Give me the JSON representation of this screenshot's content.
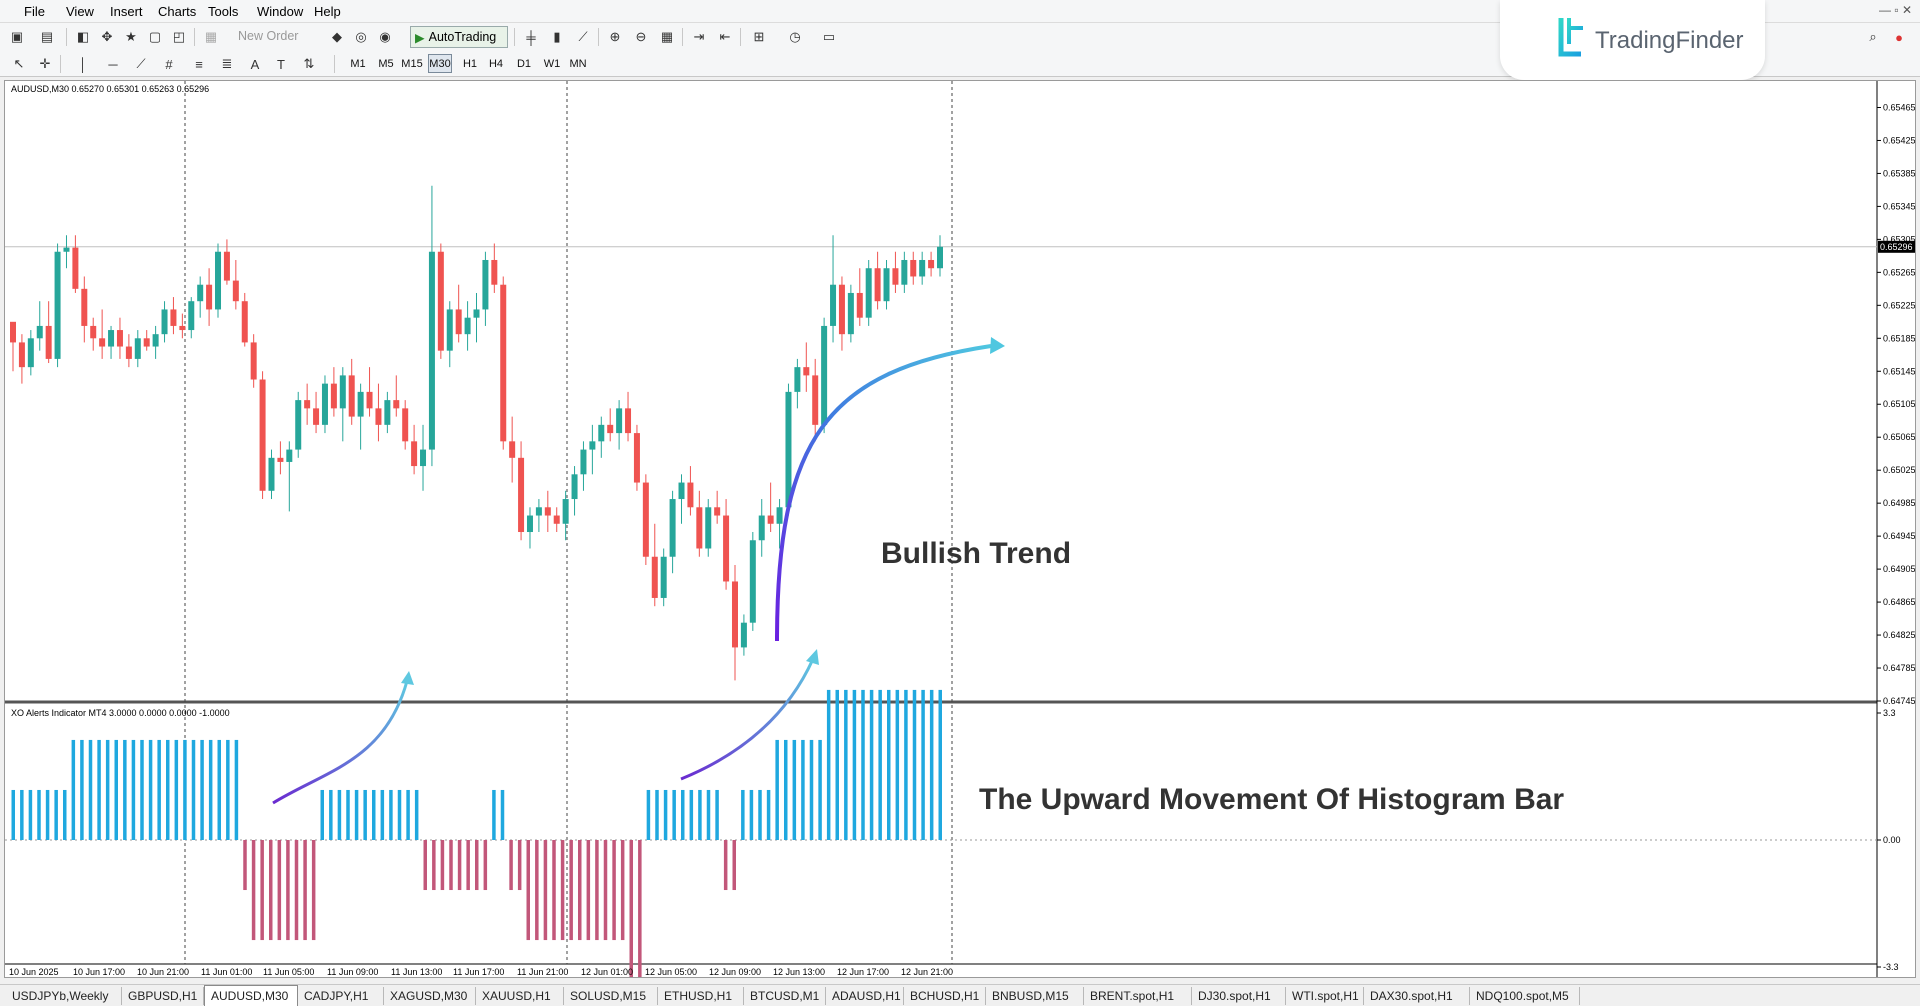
{
  "menu": [
    "File",
    "View",
    "Insert",
    "Charts",
    "Tools",
    "Window",
    "Help"
  ],
  "toolbar": {
    "new_order": "New Order",
    "autotrading": "AutoTrading"
  },
  "timeframes": [
    "M1",
    "M5",
    "M15",
    "M30",
    "H1",
    "H4",
    "D1",
    "W1",
    "MN"
  ],
  "active_timeframe": "M30",
  "logo": {
    "text": "TradingFinder"
  },
  "chart": {
    "info": "AUDUSD,M30  0.65270 0.65301 0.65263 0.65296",
    "current_price": "0.65296",
    "price_ticks": [
      "0.65465",
      "0.65425",
      "0.65385",
      "0.65345",
      "0.65305",
      "0.65265",
      "0.65225",
      "0.65185",
      "0.65145",
      "0.65105",
      "0.65065",
      "0.65025",
      "0.64985",
      "0.64945",
      "0.64905",
      "0.64865",
      "0.64825",
      "0.64785",
      "0.64745"
    ],
    "time_labels": [
      "10 Jun 2025",
      "10 Jun 17:00",
      "10 Jun 21:00",
      "11 Jun 01:00",
      "11 Jun 05:00",
      "11 Jun 09:00",
      "11 Jun 13:00",
      "11 Jun 17:00",
      "11 Jun 21:00",
      "12 Jun 01:00",
      "12 Jun 05:00",
      "12 Jun 09:00",
      "12 Jun 13:00",
      "12 Jun 17:00",
      "12 Jun 21:00"
    ],
    "indicator_info": "XO Alerts Indicator MT4 3.0000 0.0000 0.0000 -1.0000",
    "indicator_ticks": [
      "3.3",
      "0.00",
      "-3.3"
    ],
    "annotation_trend": "Bullish Trend",
    "annotation_histogram": "The Upward Movement Of Histogram Bar",
    "colors": {
      "bull": "#26a69a",
      "bear": "#ef5350",
      "hist_up": "#1fa8df",
      "hist_down": "#c2577a"
    }
  },
  "chart_data": {
    "type": "bar",
    "title": "",
    "xlabel": "",
    "ylabel": "",
    "ylim": [
      -3.3,
      3.3
    ],
    "categories": [
      "10 Jun 2025",
      "10 Jun 17:00",
      "10 Jun 21:00",
      "11 Jun 01:00",
      "11 Jun 05:00",
      "11 Jun 09:00",
      "11 Jun 13:00",
      "11 Jun 17:00",
      "11 Jun 21:00",
      "12 Jun 01:00",
      "12 Jun 05:00",
      "12 Jun 09:00",
      "12 Jun 13:00",
      "12 Jun 17:00",
      "12 Jun 21:00"
    ],
    "candles": [
      [
        0.65205,
        0.652,
        0.65145,
        0.6518
      ],
      [
        0.6518,
        0.6519,
        0.6513,
        0.6515
      ],
      [
        0.6515,
        0.65195,
        0.6514,
        0.65185
      ],
      [
        0.65185,
        0.6523,
        0.6517,
        0.652
      ],
      [
        0.652,
        0.6523,
        0.65155,
        0.6516
      ],
      [
        0.6516,
        0.653,
        0.6515,
        0.6529
      ],
      [
        0.6529,
        0.6531,
        0.6527,
        0.65295
      ],
      [
        0.65295,
        0.6531,
        0.6524,
        0.65245
      ],
      [
        0.65245,
        0.6526,
        0.6518,
        0.652
      ],
      [
        0.652,
        0.6521,
        0.6517,
        0.65185
      ],
      [
        0.65185,
        0.6522,
        0.6516,
        0.65175
      ],
      [
        0.65175,
        0.652,
        0.6516,
        0.65195
      ],
      [
        0.65195,
        0.6521,
        0.6516,
        0.65175
      ],
      [
        0.65175,
        0.6519,
        0.6515,
        0.6516
      ],
      [
        0.6516,
        0.65195,
        0.6515,
        0.65185
      ],
      [
        0.65185,
        0.65195,
        0.6517,
        0.65175
      ],
      [
        0.65175,
        0.652,
        0.6516,
        0.6519
      ],
      [
        0.6519,
        0.6523,
        0.6518,
        0.6522
      ],
      [
        0.6522,
        0.65235,
        0.6519,
        0.652
      ],
      [
        0.652,
        0.65215,
        0.65185,
        0.65195
      ],
      [
        0.65195,
        0.65235,
        0.65185,
        0.6523
      ],
      [
        0.6523,
        0.6526,
        0.6521,
        0.6525
      ],
      [
        0.6525,
        0.6527,
        0.652,
        0.6522
      ],
      [
        0.6522,
        0.653,
        0.6521,
        0.6529
      ],
      [
        0.6529,
        0.65305,
        0.6525,
        0.65255
      ],
      [
        0.65255,
        0.6528,
        0.6522,
        0.6523
      ],
      [
        0.6523,
        0.6524,
        0.65175,
        0.6518
      ],
      [
        0.6518,
        0.6519,
        0.65125,
        0.65135
      ],
      [
        0.65135,
        0.65145,
        0.6499,
        0.65
      ],
      [
        0.65,
        0.6505,
        0.6499,
        0.6504
      ],
      [
        0.6504,
        0.6506,
        0.6502,
        0.65035
      ],
      [
        0.65035,
        0.6506,
        0.64975,
        0.6505
      ],
      [
        0.6505,
        0.6512,
        0.6504,
        0.6511
      ],
      [
        0.6511,
        0.6513,
        0.6508,
        0.651
      ],
      [
        0.651,
        0.6512,
        0.6507,
        0.6508
      ],
      [
        0.6508,
        0.6514,
        0.6507,
        0.6513
      ],
      [
        0.6513,
        0.6515,
        0.6509,
        0.651
      ],
      [
        0.651,
        0.6515,
        0.6506,
        0.6514
      ],
      [
        0.6514,
        0.6516,
        0.6508,
        0.6509
      ],
      [
        0.6509,
        0.6513,
        0.6505,
        0.6512
      ],
      [
        0.6512,
        0.6515,
        0.6509,
        0.651
      ],
      [
        0.651,
        0.6513,
        0.6506,
        0.6508
      ],
      [
        0.6508,
        0.6512,
        0.6507,
        0.6511
      ],
      [
        0.6511,
        0.6514,
        0.6509,
        0.651
      ],
      [
        0.651,
        0.6511,
        0.6505,
        0.6506
      ],
      [
        0.6506,
        0.6508,
        0.6502,
        0.6503
      ],
      [
        0.6503,
        0.6508,
        0.65,
        0.6505
      ],
      [
        0.6505,
        0.6537,
        0.6503,
        0.6529
      ],
      [
        0.6529,
        0.653,
        0.6516,
        0.6517
      ],
      [
        0.6517,
        0.6523,
        0.6515,
        0.6522
      ],
      [
        0.6522,
        0.6525,
        0.6518,
        0.6519
      ],
      [
        0.6519,
        0.6523,
        0.6517,
        0.6521
      ],
      [
        0.6521,
        0.6524,
        0.6518,
        0.6522
      ],
      [
        0.6522,
        0.6529,
        0.652,
        0.6528
      ],
      [
        0.6528,
        0.653,
        0.6524,
        0.6525
      ],
      [
        0.6525,
        0.6526,
        0.6505,
        0.6506
      ],
      [
        0.6506,
        0.6509,
        0.6501,
        0.6504
      ],
      [
        0.6504,
        0.6506,
        0.6494,
        0.6495
      ],
      [
        0.6495,
        0.6498,
        0.6493,
        0.6497
      ],
      [
        0.6497,
        0.6499,
        0.6495,
        0.6498
      ],
      [
        0.6498,
        0.65,
        0.6495,
        0.6497
      ],
      [
        0.6497,
        0.6498,
        0.6495,
        0.6496
      ],
      [
        0.6496,
        0.65,
        0.6494,
        0.6499
      ],
      [
        0.6499,
        0.6503,
        0.6497,
        0.6502
      ],
      [
        0.6502,
        0.6506,
        0.65,
        0.6505
      ],
      [
        0.6505,
        0.6508,
        0.6502,
        0.6506
      ],
      [
        0.6506,
        0.6509,
        0.6504,
        0.6508
      ],
      [
        0.6508,
        0.651,
        0.6506,
        0.6507
      ],
      [
        0.6507,
        0.6511,
        0.6505,
        0.651
      ],
      [
        0.651,
        0.6512,
        0.6506,
        0.6507
      ],
      [
        0.6507,
        0.6508,
        0.65,
        0.6501
      ],
      [
        0.6501,
        0.6502,
        0.6491,
        0.6492
      ],
      [
        0.6492,
        0.6496,
        0.6486,
        0.6487
      ],
      [
        0.6487,
        0.6493,
        0.6486,
        0.6492
      ],
      [
        0.6492,
        0.65,
        0.649,
        0.6499
      ],
      [
        0.6499,
        0.6502,
        0.6496,
        0.6501
      ],
      [
        0.6501,
        0.6503,
        0.6497,
        0.6498
      ],
      [
        0.6498,
        0.65,
        0.6492,
        0.6493
      ],
      [
        0.6493,
        0.6499,
        0.6492,
        0.6498
      ],
      [
        0.6498,
        0.65,
        0.6496,
        0.6497
      ],
      [
        0.6497,
        0.6499,
        0.6488,
        0.6489
      ],
      [
        0.6489,
        0.6491,
        0.6477,
        0.6481
      ],
      [
        0.6481,
        0.6485,
        0.648,
        0.6484
      ],
      [
        0.6484,
        0.6495,
        0.6483,
        0.6494
      ],
      [
        0.6494,
        0.6499,
        0.6492,
        0.6497
      ],
      [
        0.6497,
        0.6501,
        0.6495,
        0.6496
      ],
      [
        0.6496,
        0.6499,
        0.6493,
        0.6498
      ],
      [
        0.6498,
        0.6513,
        0.6497,
        0.6512
      ],
      [
        0.6512,
        0.6516,
        0.651,
        0.6515
      ],
      [
        0.6515,
        0.6518,
        0.6512,
        0.6514
      ],
      [
        0.6514,
        0.6516,
        0.6506,
        0.6508
      ],
      [
        0.6508,
        0.6521,
        0.6507,
        0.652
      ],
      [
        0.652,
        0.6531,
        0.6518,
        0.6525
      ],
      [
        0.6525,
        0.6526,
        0.6517,
        0.6519
      ],
      [
        0.6519,
        0.6525,
        0.6518,
        0.6524
      ],
      [
        0.6524,
        0.6527,
        0.652,
        0.6521
      ],
      [
        0.6521,
        0.6528,
        0.652,
        0.6527
      ],
      [
        0.6527,
        0.6529,
        0.6522,
        0.6523
      ],
      [
        0.6523,
        0.6528,
        0.6522,
        0.6527
      ],
      [
        0.6527,
        0.6529,
        0.6524,
        0.6525
      ],
      [
        0.6525,
        0.6529,
        0.6524,
        0.6528
      ],
      [
        0.6528,
        0.6529,
        0.6525,
        0.6526
      ],
      [
        0.6526,
        0.6529,
        0.6525,
        0.6528
      ],
      [
        0.6528,
        0.6529,
        0.6526,
        0.6527
      ],
      [
        0.6527,
        0.6531,
        0.6526,
        0.65296
      ]
    ],
    "histogram": [
      1,
      1,
      1,
      1,
      1,
      1,
      1,
      2,
      2,
      2,
      2,
      2,
      2,
      2,
      2,
      2,
      2,
      2,
      2,
      2,
      2,
      2,
      2,
      2,
      2,
      2,
      2,
      -1,
      -2,
      -2,
      -2,
      -2,
      -2,
      -2,
      -2,
      -2,
      1,
      1,
      1,
      1,
      1,
      1,
      1,
      1,
      1,
      1,
      1,
      1,
      -1,
      -1,
      -1,
      -1,
      -1,
      -1,
      -1,
      -1,
      1,
      1,
      -1,
      -1,
      -2,
      -2,
      -2,
      -2,
      -2,
      -2,
      -2,
      -2,
      -2,
      -2,
      -2,
      -2,
      -3,
      -3,
      1,
      1,
      1,
      1,
      1,
      1,
      1,
      1,
      1,
      -1,
      -1,
      1,
      1,
      1,
      1,
      2,
      2,
      2,
      2,
      2,
      2,
      3,
      3,
      3,
      3,
      3,
      3,
      3,
      3,
      3,
      3,
      3,
      3,
      3,
      3
    ],
    "price_ylim": [
      0.64745,
      0.65485
    ],
    "grid": false
  },
  "tabs": [
    "USDJPYb,Weekly",
    "GBPUSD,H1",
    "AUDUSD,M30",
    "CADJPY,H1",
    "XAGUSD,M30",
    "XAUUSD,H1",
    "SOLUSD,M15",
    "ETHUSD,H1",
    "BTCUSD,M1",
    "ADAUSD,H1",
    "BCHUSD,H1",
    "BNBUSD,M15",
    "BRENT.spot,H1",
    "DJ30.spot,H1",
    "WTI.spot,H1",
    "DAX30.spot,H1",
    "NDQ100.spot,M5"
  ],
  "active_tab": "AUDUSD,M30"
}
